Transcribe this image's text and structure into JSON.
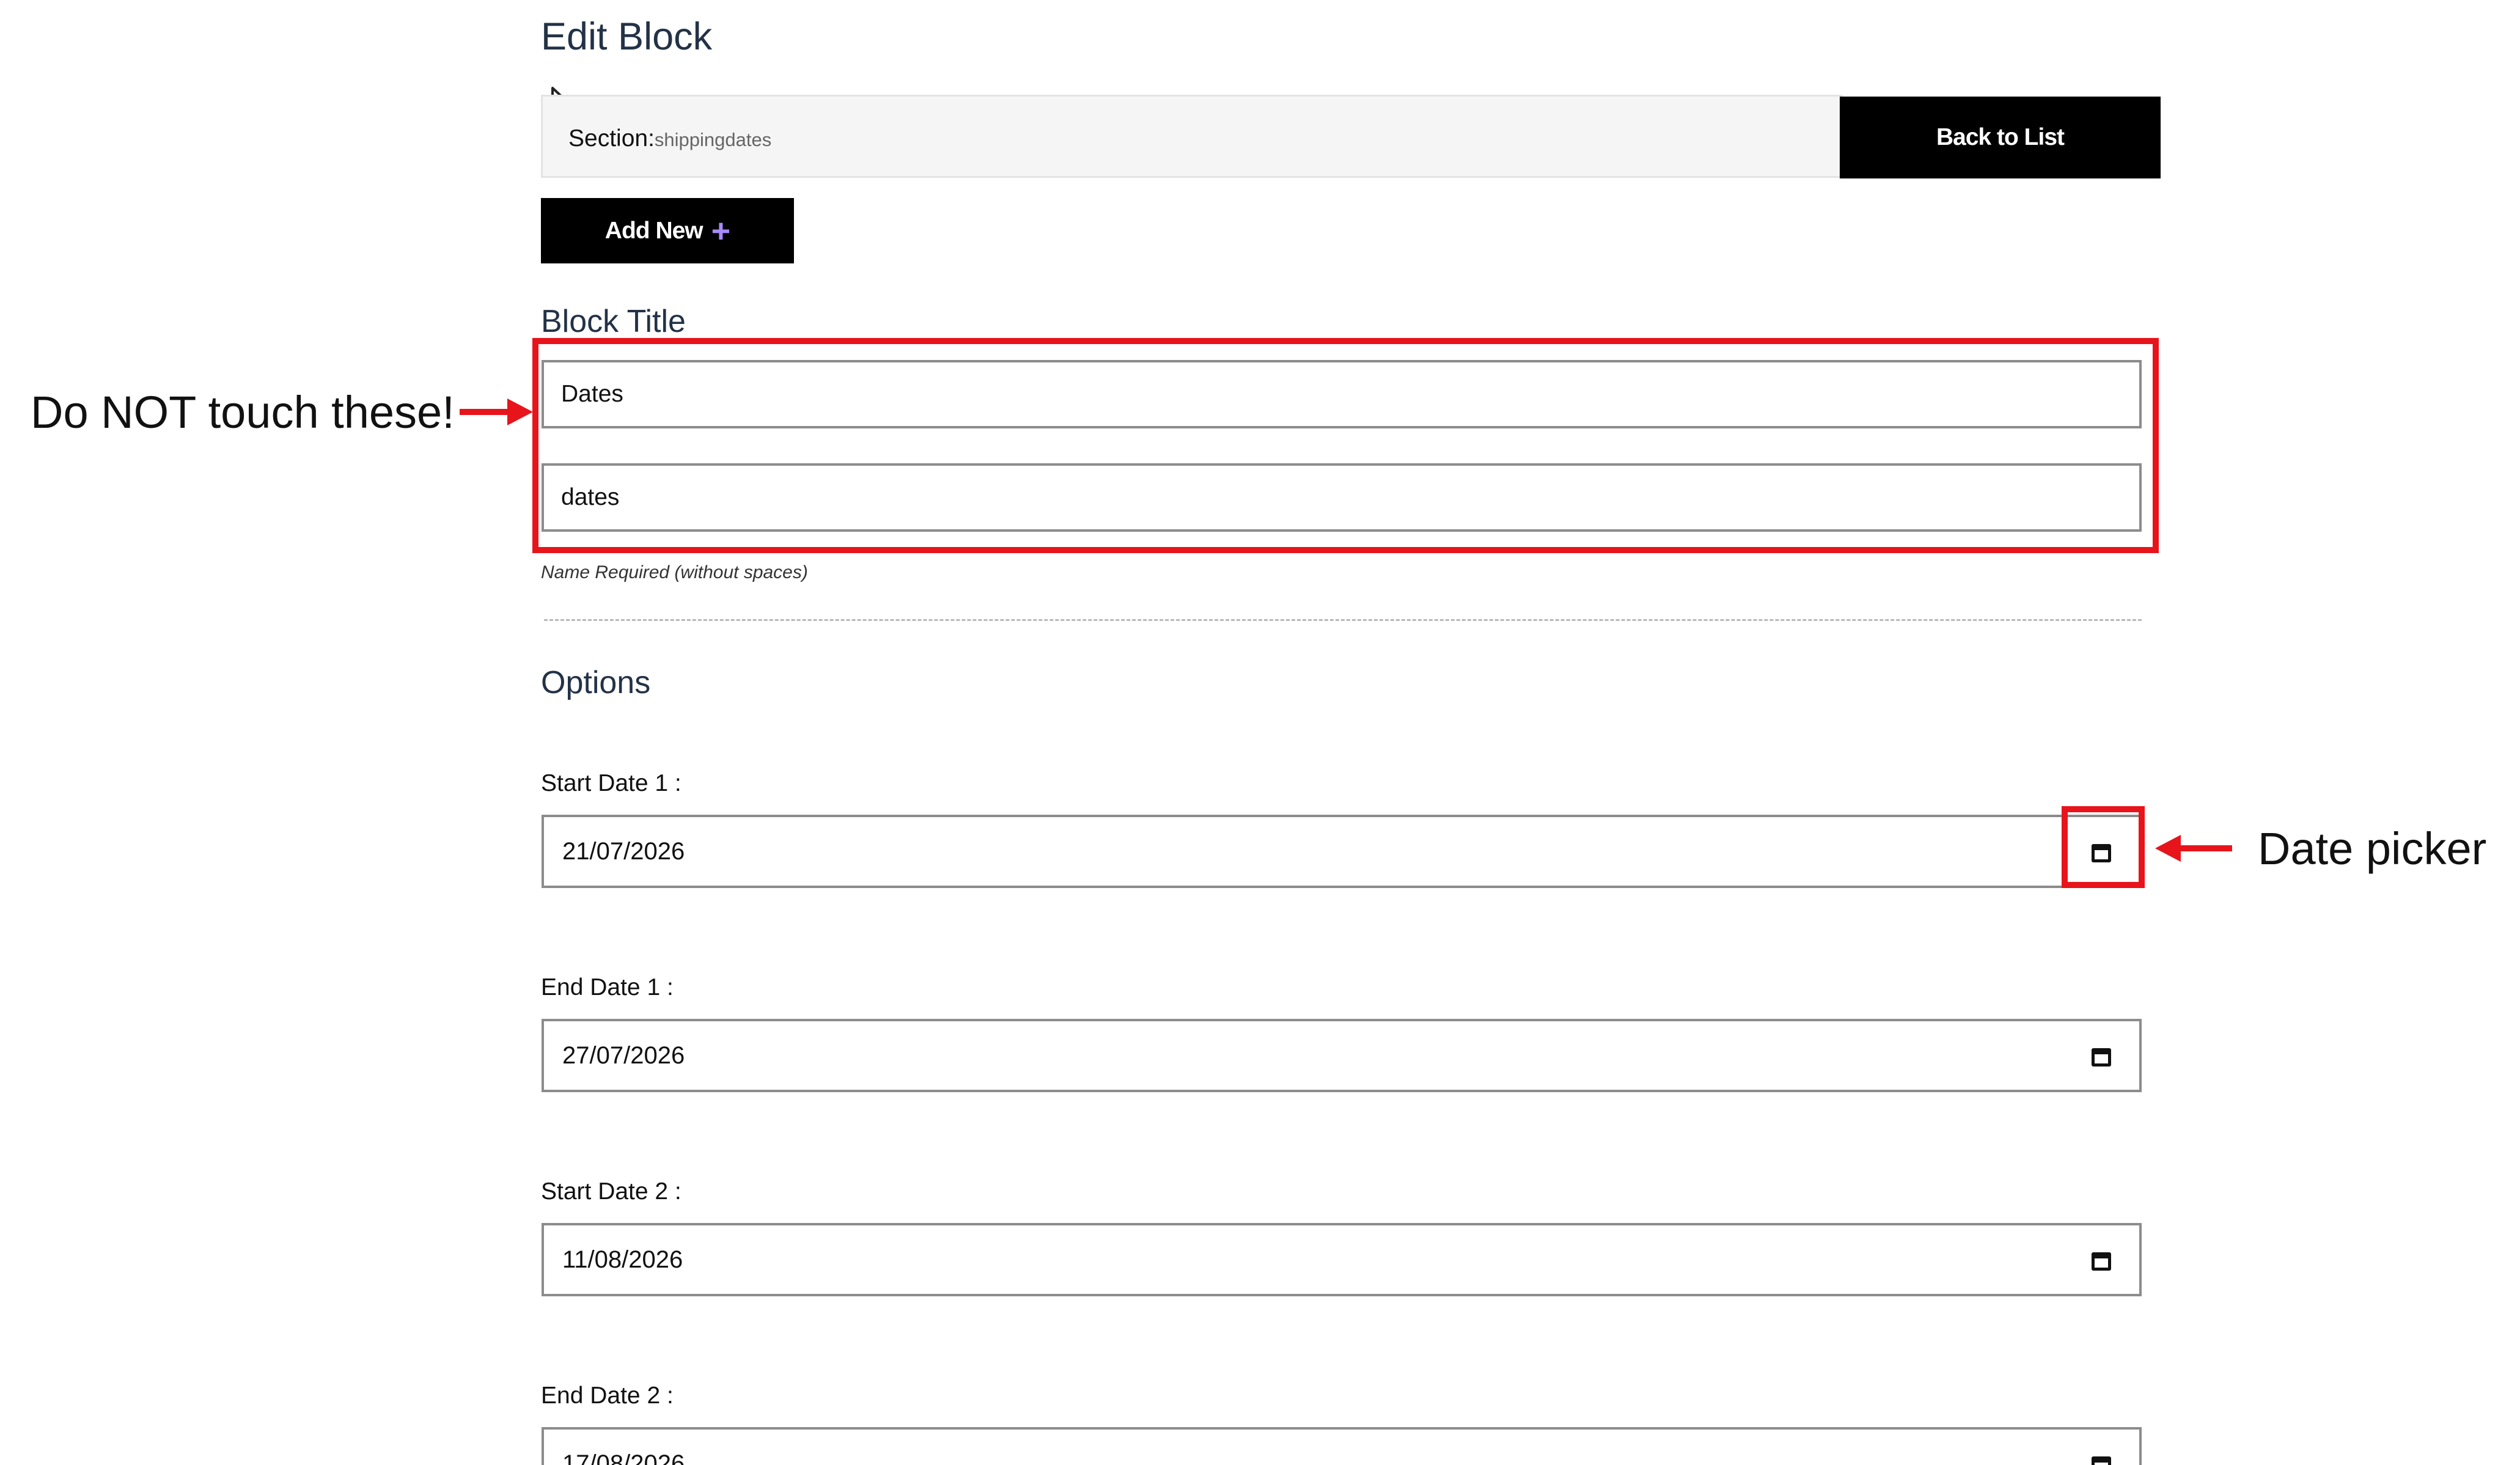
{
  "page": {
    "title": "Edit Block"
  },
  "section_bar": {
    "label": "Section:",
    "value": "shippingdates",
    "back_button_label": "Back to List"
  },
  "toolbar": {
    "add_new_label": "Add New",
    "add_new_icon": "plus-icon",
    "add_new_icon_color": "#a78bfa"
  },
  "block_title": {
    "label": "Block Title",
    "title_value": "Dates",
    "name_value": "dates",
    "helper_text": "Name Required (without spaces)"
  },
  "options": {
    "heading": "Options",
    "fields": [
      {
        "label": "Start Date 1 :",
        "value": "21/07/2026"
      },
      {
        "label": "End Date 1 :",
        "value": "27/07/2026"
      },
      {
        "label": "Start Date 2 :",
        "value": "11/08/2026"
      },
      {
        "label": "End Date 2 :",
        "value": "17/08/2026"
      }
    ],
    "picker_icon": "calendar-icon"
  },
  "annotations": {
    "warning_text": "Do NOT touch these!",
    "picker_text": "Date picker",
    "highlight_color": "#e8141b"
  }
}
